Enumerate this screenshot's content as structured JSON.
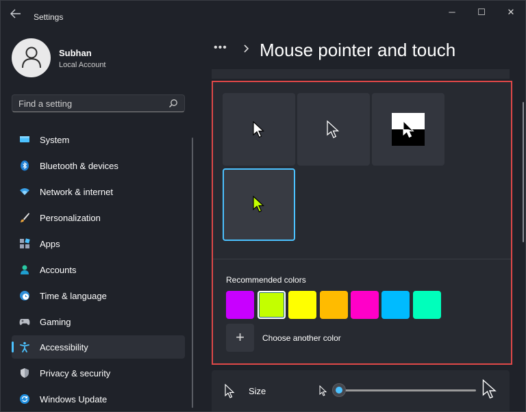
{
  "window": {
    "title": "Settings",
    "back_icon": "arrow-left-icon",
    "controls": {
      "minimize": "─",
      "maximize": "☐",
      "close": "✕"
    }
  },
  "profile": {
    "name": "Subhan",
    "account_type": "Local Account"
  },
  "search": {
    "placeholder": "Find a setting",
    "icon": "search-icon"
  },
  "sidebar": {
    "items": [
      {
        "label": "System",
        "icon": "system-icon",
        "active": false
      },
      {
        "label": "Bluetooth & devices",
        "icon": "bluetooth-icon",
        "active": false
      },
      {
        "label": "Network & internet",
        "icon": "wifi-icon",
        "active": false
      },
      {
        "label": "Personalization",
        "icon": "brush-icon",
        "active": false
      },
      {
        "label": "Apps",
        "icon": "apps-icon",
        "active": false
      },
      {
        "label": "Accounts",
        "icon": "accounts-icon",
        "active": false
      },
      {
        "label": "Time & language",
        "icon": "globe-clock-icon",
        "active": false
      },
      {
        "label": "Gaming",
        "icon": "gamepad-icon",
        "active": false
      },
      {
        "label": "Accessibility",
        "icon": "accessibility-icon",
        "active": true
      },
      {
        "label": "Privacy & security",
        "icon": "shield-icon",
        "active": false
      },
      {
        "label": "Windows Update",
        "icon": "update-icon",
        "active": false
      }
    ]
  },
  "header": {
    "more": "•••",
    "title": "Mouse pointer and touch"
  },
  "pointer_styles": {
    "options": [
      {
        "name": "white",
        "selected": false
      },
      {
        "name": "black",
        "selected": false
      },
      {
        "name": "inverted",
        "selected": false
      },
      {
        "name": "custom",
        "selected": true,
        "color": "#c3ff00"
      }
    ]
  },
  "colors": {
    "label": "Recommended colors",
    "swatches": [
      "#c800ff",
      "#c3ff00",
      "#ffff00",
      "#ffbb00",
      "#ff00c8",
      "#00bbff",
      "#00ffbb"
    ],
    "selected_index": 1,
    "add_label": "Choose another color",
    "add_symbol": "+"
  },
  "size": {
    "label": "Size",
    "value_fraction": 0.0
  },
  "theme": {
    "accent": "#4cc2ff",
    "highlight_border": "#e04848"
  }
}
